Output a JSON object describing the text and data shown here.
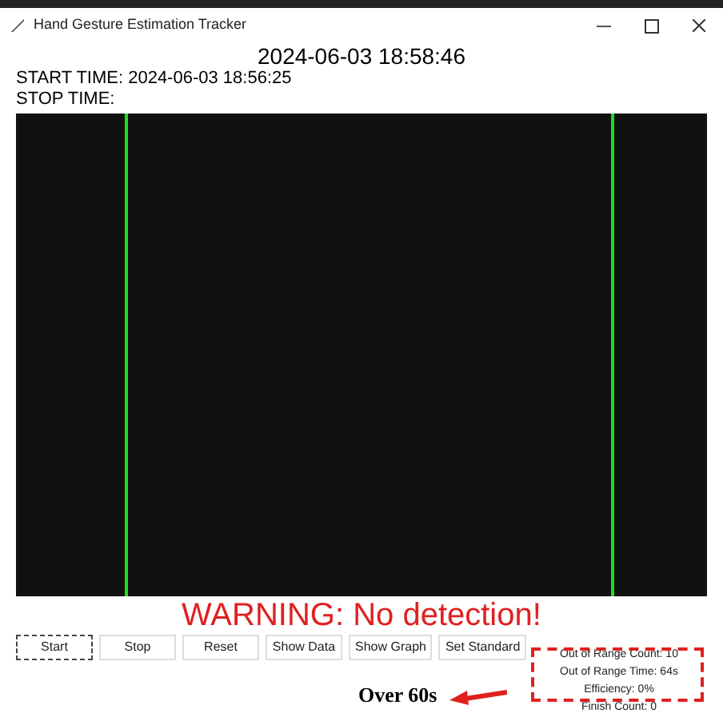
{
  "window": {
    "title": "Hand Gesture Estimation Tracker"
  },
  "clock": "2024-06-03 18:58:46",
  "start_time": "START TIME: 2024-06-03 18:56:25",
  "stop_time": "STOP TIME:",
  "warning": "WARNING: No detection!",
  "buttons": [
    {
      "label": "Start",
      "focused": true
    },
    {
      "label": "Stop",
      "focused": false
    },
    {
      "label": "Reset",
      "focused": false
    },
    {
      "label": "Show Data",
      "focused": false
    },
    {
      "label": "Show Graph",
      "focused": false
    },
    {
      "label": "Set Standard",
      "focused": false
    }
  ],
  "annotation": "Over 60s",
  "stats": [
    "Out of Range Count: 10",
    "Out of Range Time: 64s",
    "Efficiency: 0%",
    "Finish Count: 0"
  ]
}
